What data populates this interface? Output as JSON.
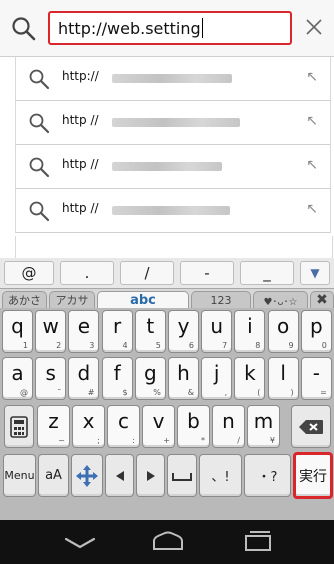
{
  "address_bar": {
    "url": "http://web.setting"
  },
  "suggestions": [
    {
      "prefix": "http://"
    },
    {
      "prefix": "http //"
    },
    {
      "prefix": "http //"
    },
    {
      "prefix": "http //"
    }
  ],
  "keyboard": {
    "symbol_row": [
      "@",
      ".",
      "/",
      "-",
      "_"
    ],
    "mode_tabs": [
      "あかさ",
      "アカサ",
      "abc",
      "123"
    ],
    "active_mode": "abc",
    "emoji_tab": "♥･ᴗ･☆",
    "row1": [
      {
        "main": "q",
        "sub": "1"
      },
      {
        "main": "w",
        "sub": "2"
      },
      {
        "main": "e",
        "sub": "3"
      },
      {
        "main": "r",
        "sub": "4"
      },
      {
        "main": "t",
        "sub": "5"
      },
      {
        "main": "y",
        "sub": "6"
      },
      {
        "main": "u",
        "sub": "7"
      },
      {
        "main": "i",
        "sub": "8"
      },
      {
        "main": "o",
        "sub": "9"
      },
      {
        "main": "p",
        "sub": "0"
      }
    ],
    "row2": [
      {
        "main": "a",
        "sub": "@"
      },
      {
        "main": "s",
        "sub": "˜"
      },
      {
        "main": "d",
        "sub": "#"
      },
      {
        "main": "f",
        "sub": "$"
      },
      {
        "main": "g",
        "sub": "%"
      },
      {
        "main": "h",
        "sub": "&"
      },
      {
        "main": "j",
        "sub": ","
      },
      {
        "main": "k",
        "sub": "("
      },
      {
        "main": "l",
        "sub": ")"
      },
      {
        "main": "-",
        "sub": "="
      }
    ],
    "row3": [
      {
        "main": "z",
        "sub": "~"
      },
      {
        "main": "x",
        "sub": ";"
      },
      {
        "main": "c",
        "sub": ":"
      },
      {
        "main": "v",
        "sub": "+"
      },
      {
        "main": "b",
        "sub": "*"
      },
      {
        "main": "n",
        "sub": "/"
      },
      {
        "main": "m",
        "sub": "¥"
      }
    ],
    "row4": {
      "menu": "Menu",
      "case": "aA",
      "punct1": "、!",
      "punct2": "・?",
      "exec": "実行"
    }
  },
  "colors": {
    "accent_red": "#d9262b"
  }
}
